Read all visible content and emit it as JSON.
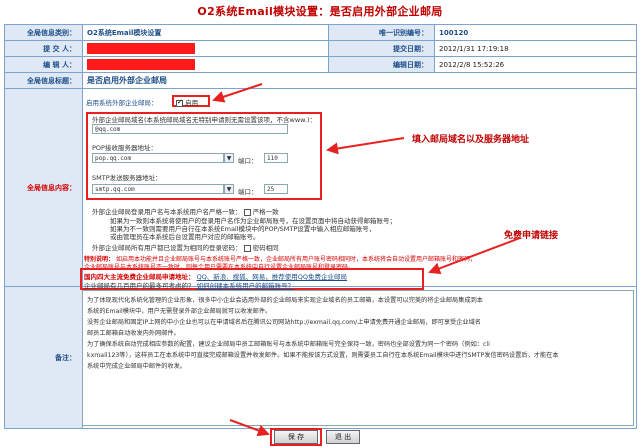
{
  "title": "O2系统Email模块设置：是否启用外部企业邮局",
  "header": {
    "category_label": "全局信息类别：",
    "category_value": "O2系统Email模块设置",
    "id_label": "唯一识别编号：",
    "id_value": "100120",
    "submitter_label": "提 交 人：",
    "submit_date_label": "提交日期：",
    "submit_date_value": "2012/1/31 17:19:18",
    "editor_label": "编 辑 人：",
    "edit_date_label": "编辑日期：",
    "edit_date_value": "2012/2/8 15:52:26"
  },
  "main": {
    "global_title_label": "全局信息标题：",
    "global_title_value": "是否启用外部企业邮局",
    "content_label": "全局信息内容：",
    "enable_label": "启用系统外部企业邮局：",
    "enable_checkbox_text": "启用",
    "domain_hint": "外部企业邮局域名(本系统邮局域名无特别申请则无需设置该项，不含www.)：",
    "domain_value": "@qq.com",
    "pop_label": "POP接收服务器地址：",
    "pop_value": "pop.qq.com",
    "pop_port_label": "端口：",
    "pop_port_value": "110",
    "smtp_label": "SMTP发送服务器地址：",
    "smtp_value": "smtp.qq.com",
    "smtp_port_label": "端口：",
    "smtp_port_value": "25",
    "login_name_label": "外部企业邮局登录用户名与本系统用户名严格一致：",
    "login_name_checkbox": "严格一致",
    "login_note1": "如果为一致则本系统将使用户的登录用户名作为企业邮局账号，在设置页面中将自动获得邮箱账号；",
    "login_note2": "如果为不一致则需要用户自行在本系统Email模块中的POP/SMTP设置中输入相应邮箱账号，",
    "login_note3": "或由管理员在本系统后台设置用户对应的邮箱账号。",
    "password_label": "外部企业邮局所有用户都已设置为相同的登录密码：",
    "password_checkbox": "密码相同",
    "special_note_label": "特别说明：",
    "special_note": "如启用本功能并且企业邮局账号与本系统账号严格一致，企业邮局所有用户账号密码相同时，本系统将会自动设置用户邮箱账号和密码，",
    "special_note2": "企业邮局账号与本系统账号不一致时，则每个用户需要在本系统中自行设置企业邮局账号和登录密码。",
    "free_apply_label": "国内四大主流免费企业邮局申请地址：",
    "free_apply_links": "QQ、新浪、搜狐、网易，推荐使用QQ免费企业邮局",
    "free_apply_hint": "企业邮局有几百用户的最多可考虑的？",
    "free_apply_link2": "如何创建本系统用户的邮箱账号？"
  },
  "remark": {
    "label": "备注：",
    "line1": "为了体现现代化系统化管理的企业形象，很多中小企业会选用外部的企业邮局来实现企业域名的员工邮箱，本设置可以完美的将企业邮局集成到本",
    "line2": "系统的Email模块中，用户无需登录外部企业邮局就可以收发邮件。",
    "line3": "没有企业邮局和固定IP上网的中小企业也可以在申请域名后在腾讯公司网站http://exmail.qq.com/上申请免费开通企业邮局，即可享受企业域名",
    "line4": "邮员工邮箱自动收发内外网邮件。",
    "line5": "为了确保系统自动完成相应参数的配置，建议企业邮局中员工邮箱账号与本系统中邮箱账号完全保持一致，密码也全部设置为同一个密码（例如：cli",
    "line6": "kxmail123等），这样员工在本系统中可直接完成邮箱设置并收发邮件。如果不能按该方式设置，则需要员工自行在本系统Email模块中进行SMTP发信密码设置后，才能在本",
    "line7": "系统中完成企业邮局中邮件的收发。"
  },
  "buttons": {
    "save": "保 存",
    "exit": "退 出"
  },
  "annotations": {
    "domain_server_note": "填入邮局域名以及服务器地址",
    "free_apply_note": "免费申请链接"
  },
  "colors": {
    "accent_red": "#e82020",
    "label_blue": "#1d4e89",
    "border_blue": "#7fa3cf",
    "label_bg": "#dfe9f5"
  }
}
